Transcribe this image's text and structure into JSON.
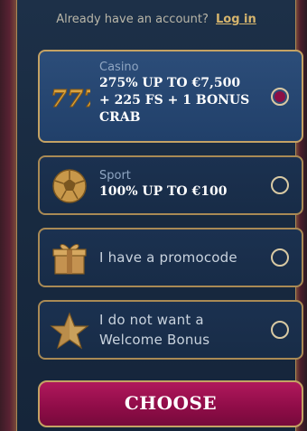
{
  "header": {
    "prompt_text": "Already have an account?",
    "login_link": "Log in"
  },
  "options": [
    {
      "id": "casino",
      "subtitle": "Casino",
      "title_lines": [
        "275% UP TO €7,500",
        "+ 225 FS + 1 BONUS",
        "CRAB"
      ],
      "icon": "slot-777-icon",
      "selected": true
    },
    {
      "id": "sport",
      "subtitle": "Sport",
      "title_lines": [
        "100% UP TO €100"
      ],
      "icon": "soccer-ball-icon",
      "selected": false
    },
    {
      "id": "promocode",
      "label_lines": [
        "I have a promocode"
      ],
      "icon": "gift-box-icon",
      "selected": false
    },
    {
      "id": "no-bonus",
      "label_lines": [
        "I do not want a",
        "Welcome Bonus"
      ],
      "icon": "star-icon",
      "selected": false
    }
  ],
  "choose_button": {
    "label": "CHOOSE"
  },
  "colors": {
    "accent_gold": "#c4a264",
    "selected_radio": "#8b0f45",
    "button_bg": "#9b1250",
    "panel_bg": "#1b3150"
  }
}
